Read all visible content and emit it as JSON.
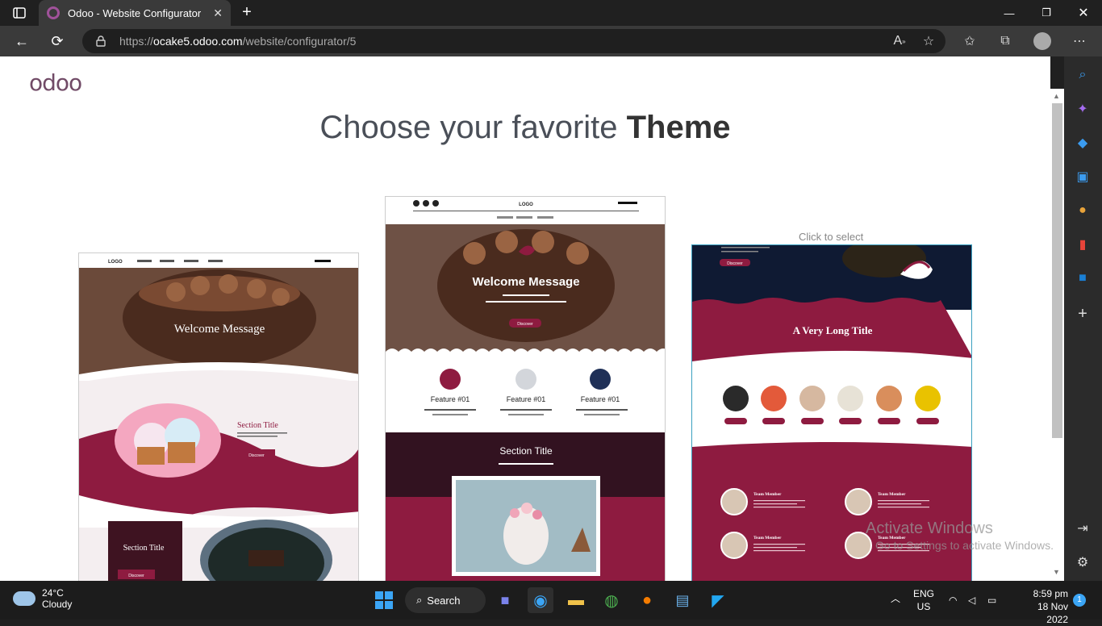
{
  "browser": {
    "tab_title": "Odoo - Website Configurator",
    "url_host": "https://ocake5.odoo.com",
    "url_path": "/website/configurator/5",
    "url_prefix": "https://",
    "url_domain": "ocake5.odoo.com"
  },
  "page": {
    "logo": "odoo",
    "headline_prefix": "Choose your favorite ",
    "headline_bold": "Theme",
    "click_to_select": "Click to select"
  },
  "themes": [
    {
      "logo": "LOGO",
      "welcome": "Welcome Message",
      "section_title": "Section Title",
      "discover": "Discover",
      "section_title_2": "Section Title",
      "discover_2": "Discover"
    },
    {
      "logo": "LOGO",
      "welcome": "Welcome Message",
      "discover": "Discover",
      "features": [
        "Feature #01",
        "Feature #01",
        "Feature #01"
      ],
      "section_title": "Section Title"
    },
    {
      "discover": "Discover",
      "long_title": "A Very Long Title",
      "team": [
        "Team Member",
        "Team Member",
        "Team Member",
        "Team Member"
      ]
    }
  ],
  "watermark": {
    "line1": "Activate Windows",
    "line2": "Go to Settings to activate Windows."
  },
  "taskbar": {
    "temp": "24°C",
    "weather": "Cloudy",
    "search": "Search",
    "lang1": "ENG",
    "lang2": "US",
    "time": "8:59 pm",
    "date": "18 Nov 2022",
    "notif": "1"
  },
  "colors": {
    "maroon": "#8e1b40",
    "navy": "#0f1a33",
    "odoo_purple": "#714b67"
  }
}
